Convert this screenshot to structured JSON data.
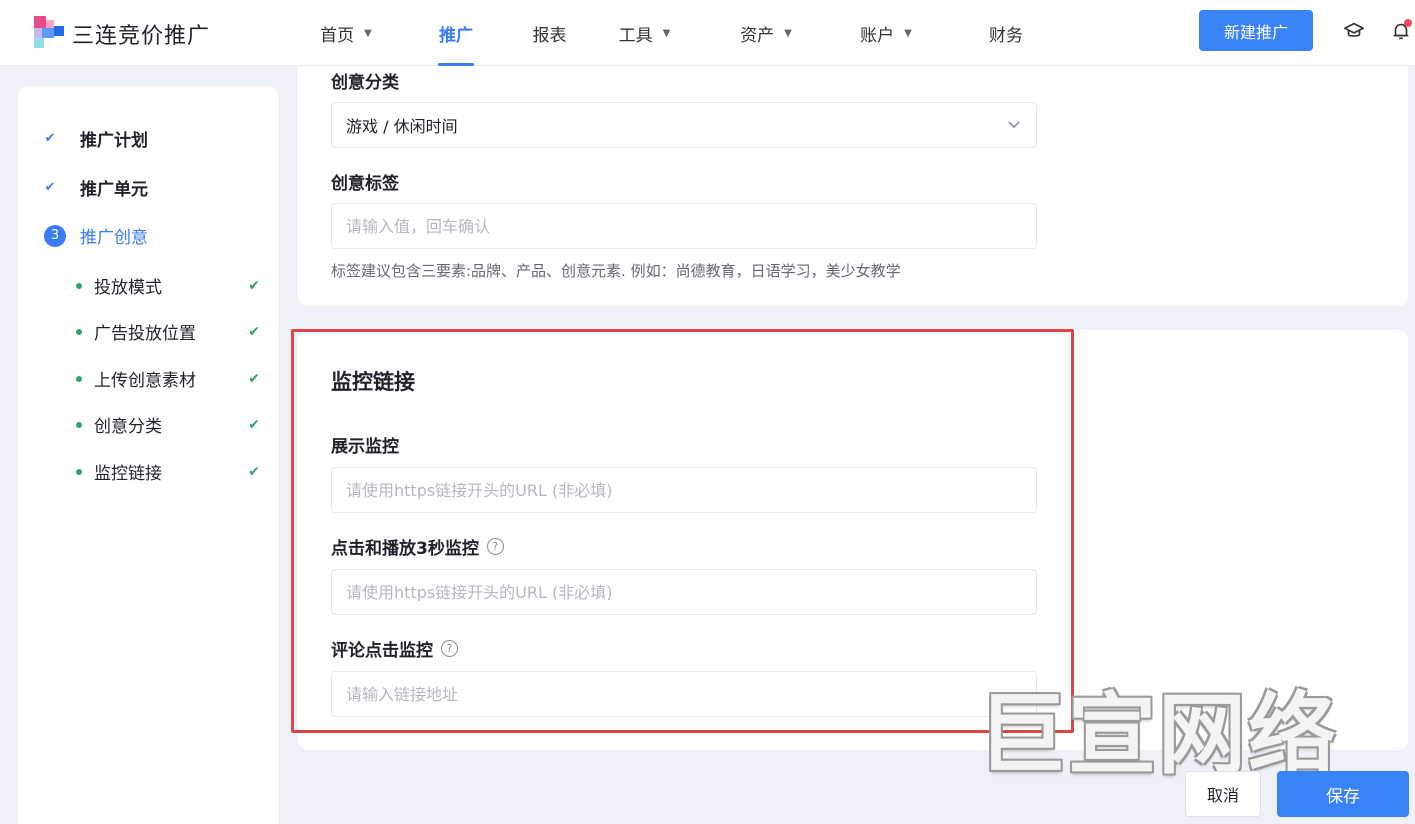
{
  "header": {
    "brand": "三连竞价推广",
    "nav": [
      {
        "label": "首页",
        "dropdown": true
      },
      {
        "label": "推广",
        "dropdown": false,
        "active": true
      },
      {
        "label": "报表",
        "dropdown": false
      },
      {
        "label": "工具",
        "dropdown": true
      },
      {
        "label": "资产",
        "dropdown": true
      },
      {
        "label": "账户",
        "dropdown": true
      },
      {
        "label": "财务",
        "dropdown": false
      }
    ],
    "new_button": "新建推广",
    "icons": [
      "graduation-cap-icon",
      "bell-icon"
    ]
  },
  "steps": [
    {
      "label": "推广计划",
      "status": "done"
    },
    {
      "label": "推广单元",
      "status": "done"
    },
    {
      "label": "推广创意",
      "status": "current",
      "number": "3"
    }
  ],
  "substeps": [
    {
      "label": "投放模式"
    },
    {
      "label": "广告投放位置"
    },
    {
      "label": "上传创意素材"
    },
    {
      "label": "创意分类"
    },
    {
      "label": "监控链接"
    }
  ],
  "creative": {
    "category_label": "创意分类",
    "category_value": "游戏 / 休闲时间",
    "tags_label": "创意标签",
    "tags_placeholder": "请输入值，回车确认",
    "tags_hint": "标签建议包含三要素:品牌、产品、创意元素. 例如：尚德教育，日语学习，美少女教学"
  },
  "monitor": {
    "title": "监控链接",
    "display_label": "展示监控",
    "display_placeholder": "请使用https链接开头的URL (非必填)",
    "click_label": "点击和播放3秒监控",
    "click_placeholder": "请使用https链接开头的URL (非必填)",
    "comment_label": "评论点击监控",
    "comment_placeholder": "请输入链接地址",
    "help_glyph": "?"
  },
  "footer": {
    "cancel": "取消",
    "save": "保存"
  },
  "watermark": "巨宣网络",
  "colors": {
    "accent": "#3a82f7",
    "success": "#2fa56d",
    "highlight": "#e04545"
  }
}
